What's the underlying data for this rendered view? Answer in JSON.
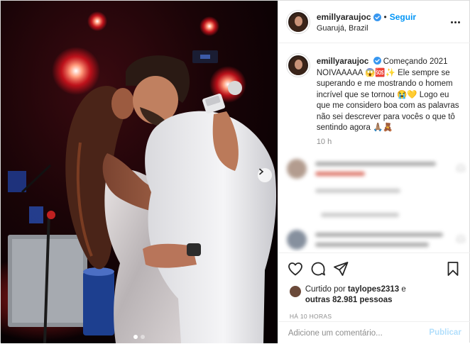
{
  "header": {
    "username": "emillyaraujoc",
    "separator": "•",
    "follow_label": "Seguir",
    "location": "Guarujá, Brazil"
  },
  "caption": {
    "username": "emillyaraujoc",
    "text": "Começando 2021 NOIVAAAAA 😱🆘✨ Ele sempre se superando e me mostrando o homem incrível que se tornou 😭💛 Logo eu que me considero boa com as palavras não sei descrever para vocês o que tô sentindo agora 🙏🏽🧸",
    "time": "10 h"
  },
  "likes": {
    "prefix": "Curtido por",
    "liker": "taylopes2313",
    "middle": "e",
    "others": "outras 82.981 pessoas"
  },
  "timeago": "HÁ 10 HORAS",
  "comment_box": {
    "placeholder": "Adicione um comentário...",
    "publish_label": "Publicar"
  },
  "icons": {
    "verified": "verified-badge-icon",
    "like": "heart-icon",
    "comment": "comment-icon",
    "share": "paper-plane-icon",
    "save": "bookmark-icon",
    "more": "more-options-icon",
    "carousel_next": "chevron-right-icon"
  },
  "colors": {
    "accent": "#0095f6",
    "verified": "#3897f0",
    "publish_disabled": "#b2dffc",
    "secondary_text": "#8e8e8e",
    "border": "#dbdbdb"
  },
  "carousel": {
    "slides": 2,
    "active": 1
  }
}
